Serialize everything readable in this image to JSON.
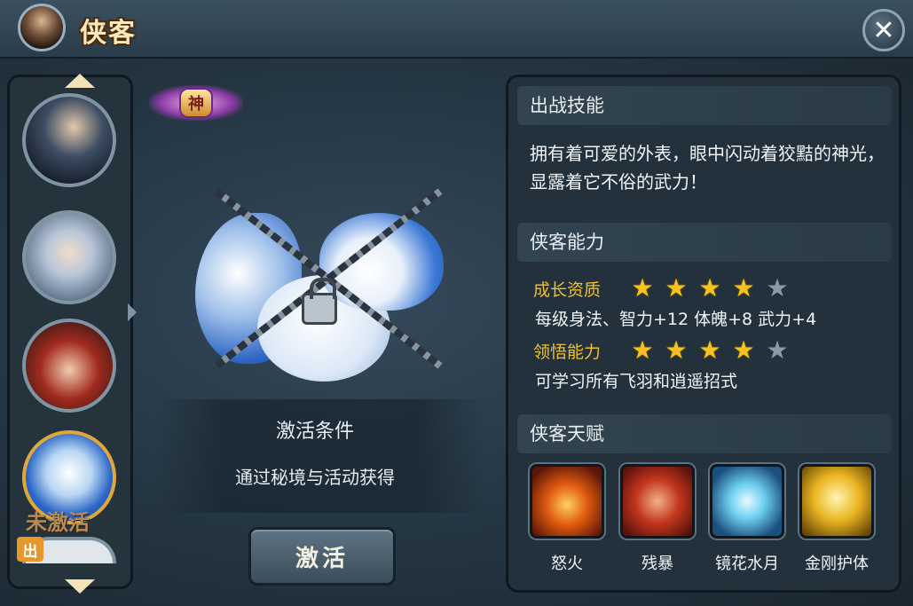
{
  "title": "侠客",
  "close_label": "✕",
  "hero_list": {
    "locked_label": "未激活",
    "deployed_badge": "出"
  },
  "pet": {
    "rank_badge": "神",
    "condition_title": "激活条件",
    "condition_text": "通过秘境与活动获得",
    "activate_label": "激活"
  },
  "skill": {
    "header": "出战技能",
    "description": "拥有着可爱的外表，眼中闪动着狡黠的神光，显露着它不俗的武力！"
  },
  "ability": {
    "header": "侠客能力",
    "growth_label": "成长资质",
    "growth_stars": 4,
    "growth_text": "每级身法、智力+12 体魄+8 武力+4",
    "insight_label": "领悟能力",
    "insight_stars": 4,
    "insight_text": "可学习所有飞羽和逍遥招式",
    "max_stars": 5
  },
  "talents": {
    "header": "侠客天赋",
    "items": [
      {
        "name": "怒火",
        "icon": "fire-rage-icon"
      },
      {
        "name": "残暴",
        "icon": "fist-icon"
      },
      {
        "name": "镜花水月",
        "icon": "water-lotus-icon"
      },
      {
        "name": "金刚护体",
        "icon": "golden-body-icon"
      }
    ]
  },
  "colors": {
    "accent_gold": "#f0c030",
    "star_on": "#f6c21f",
    "star_off": "#8d9aa4"
  }
}
